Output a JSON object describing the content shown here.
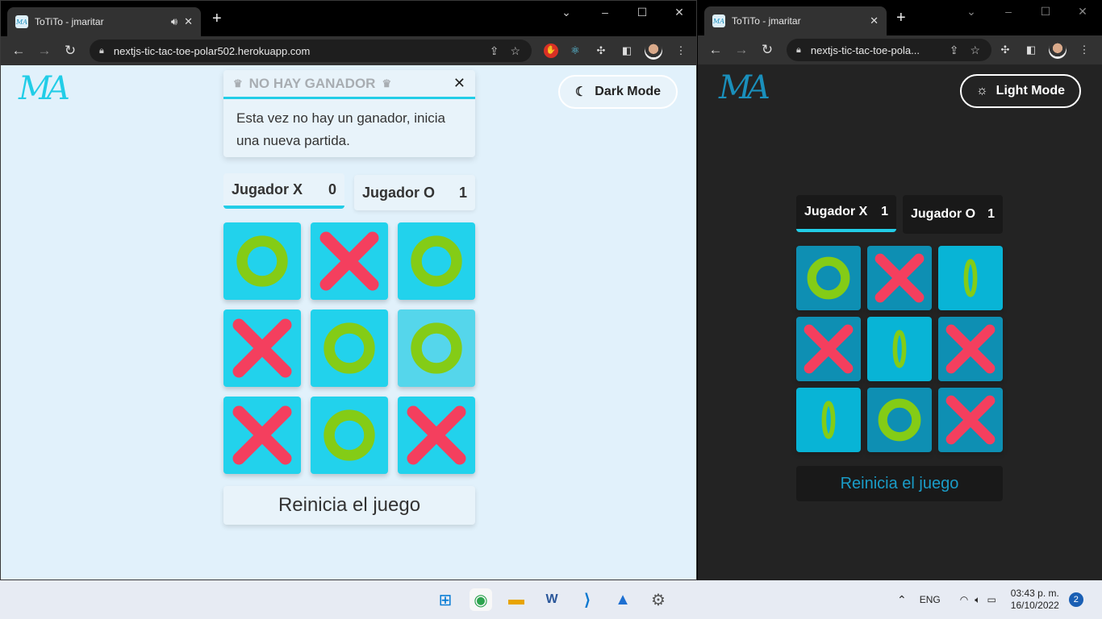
{
  "left": {
    "tab_title": "ToTiTo - jmaritar",
    "favicon_text": "MA",
    "url": "nextjs-tic-tac-toe-polar502.herokuapp.com",
    "logo": "MA",
    "mode_button": "Dark Mode",
    "toast": {
      "title": "NO HAY GANADOR",
      "message": "Esta vez no hay un ganador, inicia una nueva partida."
    },
    "players": [
      {
        "label": "Jugador X",
        "score": "0"
      },
      {
        "label": "Jugador O",
        "score": "1"
      }
    ],
    "board": [
      "O",
      "X",
      "O",
      "X",
      "O",
      "O",
      "X",
      "O",
      "X"
    ],
    "restart": "Reinicia el juego"
  },
  "right": {
    "tab_title": "ToTiTo - jmaritar",
    "favicon_text": "MA",
    "url": "nextjs-tic-tac-toe-pola...",
    "logo": "MA",
    "mode_button": "Light Mode",
    "players": [
      {
        "label": "Jugador X",
        "score": "1"
      },
      {
        "label": "Jugador O",
        "score": "1"
      }
    ],
    "board": [
      "O",
      "X",
      "O",
      "X",
      "O",
      "X",
      "O",
      "O",
      "X"
    ],
    "restart": "Reinicia el juego"
  },
  "taskbar": {
    "lang": "ENG",
    "time": "03:43 p. m.",
    "date": "16/10/2022",
    "notifications": "2"
  },
  "colors": {
    "accent": "#22cde7",
    "x_mark": "#f43f5e",
    "o_mark": "#84cc16",
    "dark_cell": "#0e8fb3"
  }
}
